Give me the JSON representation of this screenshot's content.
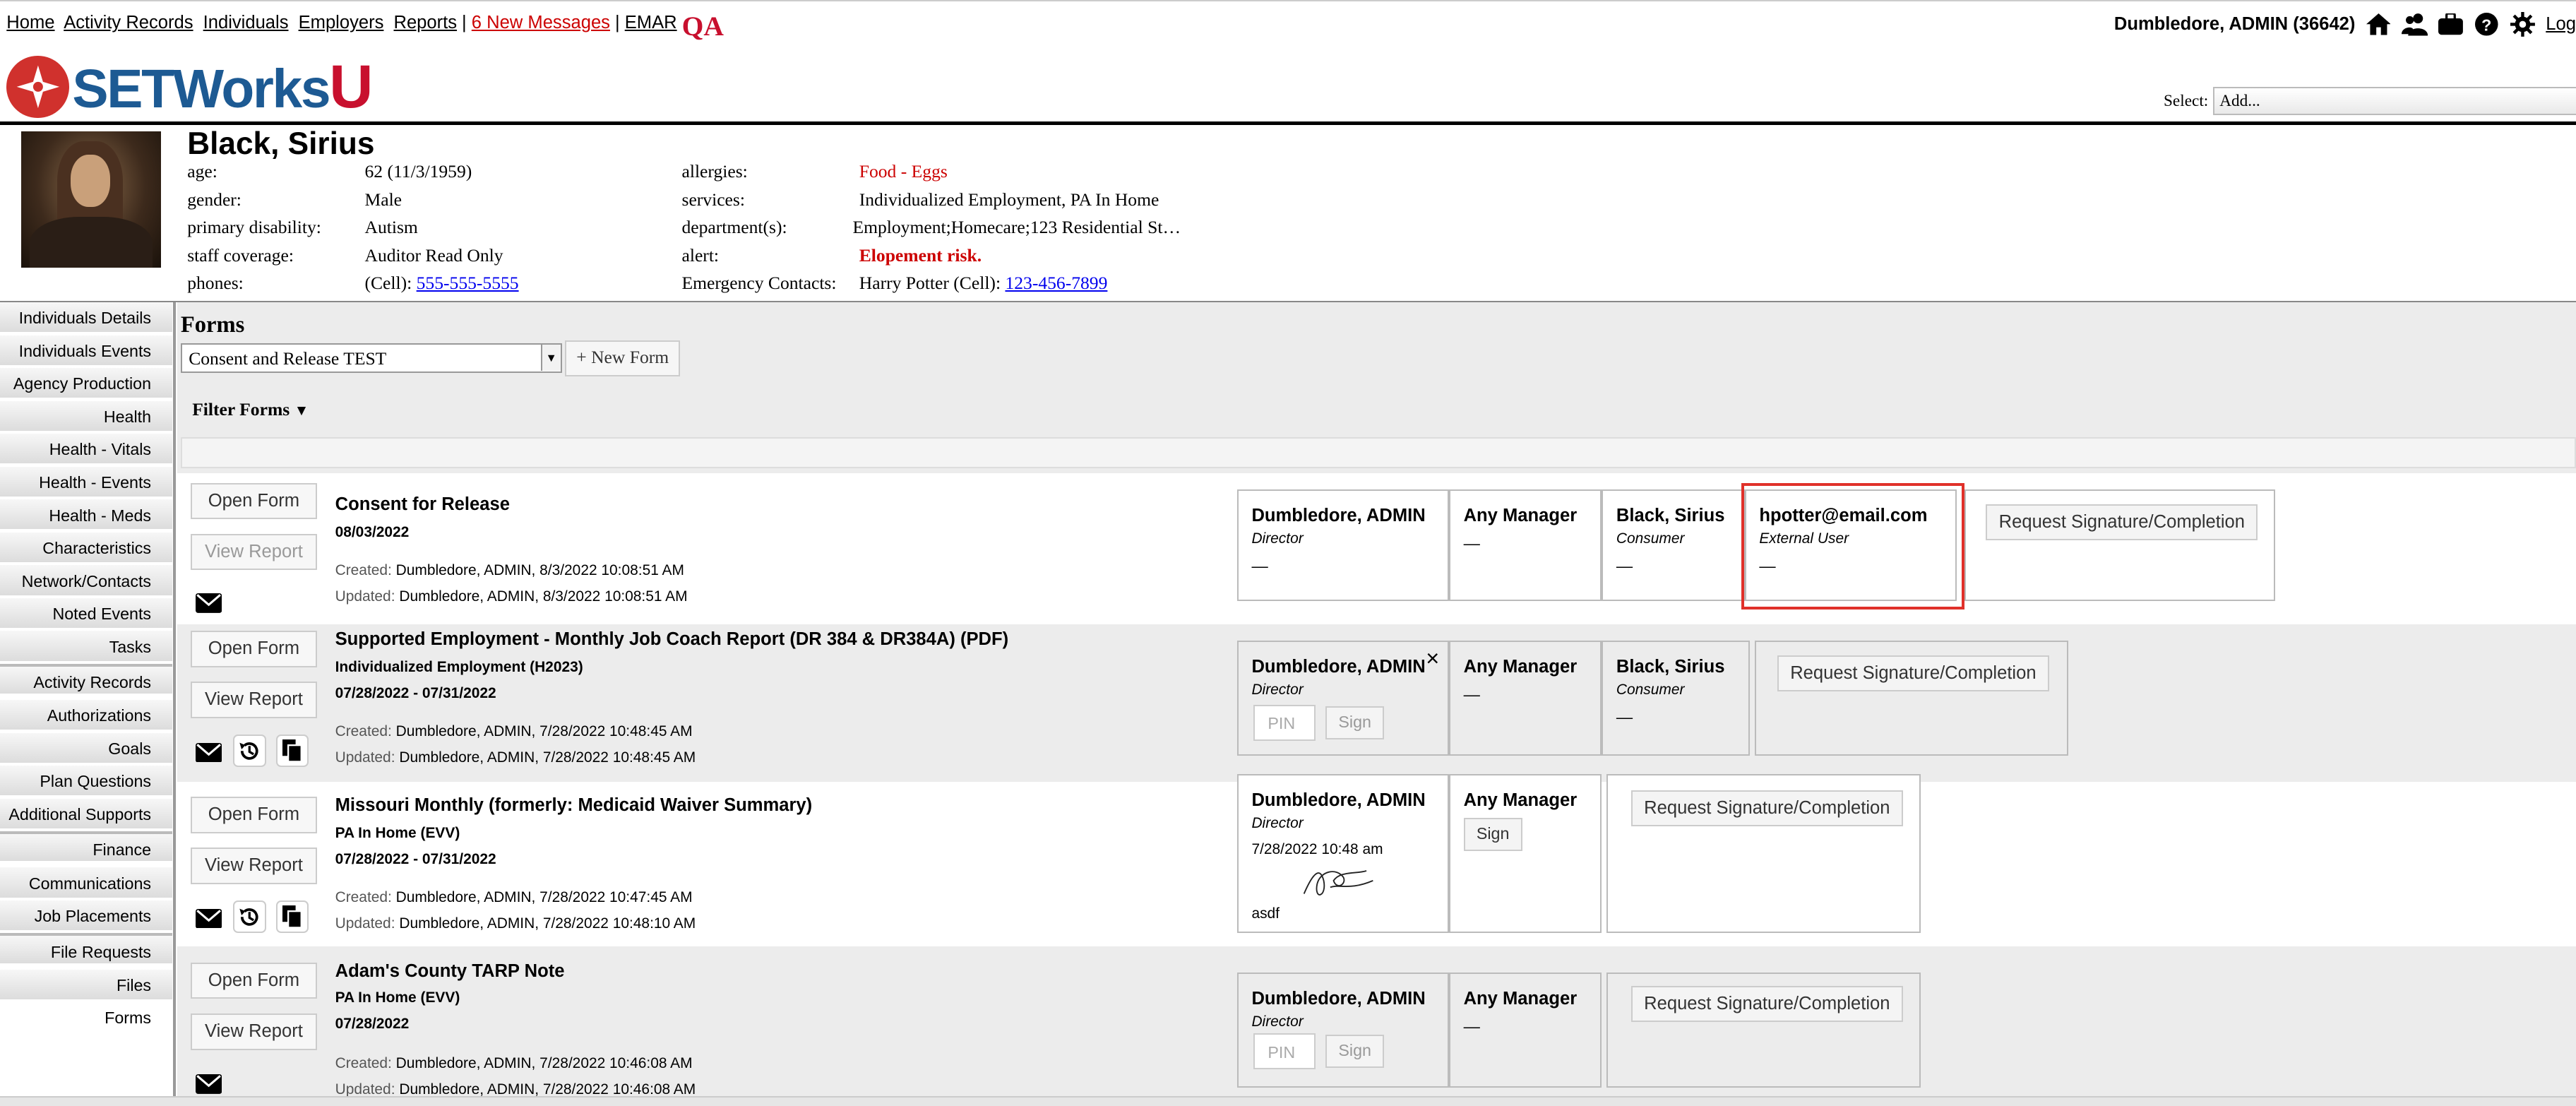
{
  "topnav": {
    "links": [
      "Home",
      "Activity Records",
      "Individuals",
      "Employers",
      "Reports"
    ],
    "separator": "|",
    "messages": "6 New Messages",
    "emar": "EMAR",
    "qa": "QA",
    "user": "Dumbledore, ADMIN  (36642)",
    "logout": "Log"
  },
  "brand": {
    "name": "SETWorks",
    "u": "U"
  },
  "select": {
    "label": "Select:",
    "value": "Add..."
  },
  "person": {
    "name": "Black, Sirius",
    "fields_left": [
      {
        "label": "age:",
        "value": "62 (11/3/1959)"
      },
      {
        "label": "gender:",
        "value": "Male"
      },
      {
        "label": "primary disability:",
        "value": "Autism"
      },
      {
        "label": "staff coverage:",
        "value": "Auditor Read Only"
      },
      {
        "label": "phones:",
        "prefix": "(Cell): ",
        "value": "555-555-5555"
      }
    ],
    "fields_right": [
      {
        "label": "allergies:",
        "value": "Food - Eggs"
      },
      {
        "label": "services:",
        "value": "Individualized Employment, PA In Home"
      },
      {
        "label": "department(s):",
        "value": "Employment;Homecare;123 Residential St…"
      },
      {
        "label": "alert:",
        "value": "Elopement risk."
      },
      {
        "label": "Emergency Contacts:",
        "prefix": "Harry Potter (Cell): ",
        "value": "123-456-7899"
      }
    ]
  },
  "sidebar": [
    "Individuals Details",
    "Individuals Events",
    "Agency Production",
    "Health",
    "Health - Vitals",
    "Health - Events",
    "Health - Meds",
    "Characteristics",
    "Network/Contacts",
    "Noted Events",
    "Tasks",
    "Activity Records",
    "Authorizations",
    "Goals",
    "Plan Questions",
    "Additional Supports",
    "Finance",
    "Communications",
    "Job Placements",
    "File Requests",
    "Files",
    "Forms"
  ],
  "forms": {
    "title": "Forms",
    "selected_form": "Consent and Release TEST",
    "new_form": "+ New Form",
    "filter": "Filter Forms",
    "open_label": "Open Form",
    "view_label": "View Report",
    "request_label": "Request Signature/Completion",
    "pin_placeholder": "PIN",
    "sign_label": "Sign",
    "created_label": "Created:",
    "updated_label": "Updated:",
    "rows": [
      {
        "title": "Consent for Release",
        "sub1": "08/03/2022",
        "sub2": "",
        "created": "Dumbledore, ADMIN, 8/3/2022 10:08:51 AM",
        "updated": "Dumbledore, ADMIN, 8/3/2022 10:08:51 AM"
      },
      {
        "title": "Supported Employment - Monthly Job Coach Report (DR 384 & DR384A) (PDF)",
        "sub1": "Individualized Employment (H2023)",
        "sub2": "07/28/2022 - 07/31/2022",
        "created": "Dumbledore, ADMIN, 7/28/2022 10:48:45 AM",
        "updated": "Dumbledore, ADMIN, 7/28/2022 10:48:45 AM"
      },
      {
        "title": "Missouri Monthly (formerly: Medicaid Waiver Summary)",
        "sub1": "PA In Home (EVV)",
        "sub2": "07/28/2022 - 07/31/2022",
        "created": "Dumbledore, ADMIN, 7/28/2022 10:47:45 AM",
        "updated": "Dumbledore, ADMIN, 7/28/2022 10:48:10 AM"
      },
      {
        "title": "Adam's County TARP Note",
        "sub1": "PA In Home (EVV)",
        "sub2": "07/28/2022",
        "created": "Dumbledore, ADMIN, 7/28/2022 10:46:08 AM",
        "updated": "Dumbledore, ADMIN, 7/28/2022 10:46:08 AM"
      }
    ],
    "signers": {
      "admin": "Dumbledore, ADMIN",
      "director": "Director",
      "manager": "Any Manager",
      "consumer_name": "Black, Sirius",
      "consumer": "Consumer",
      "external_email": "hpotter@email.com",
      "external": "External User",
      "dash": "—",
      "signed_time": "7/28/2022 10:48 am",
      "signed_note": "asdf",
      "close": "×"
    }
  },
  "colors": {
    "brand_red": "#c8102e",
    "brand_blue": "#1d5a93",
    "highlight": "#e0312a"
  }
}
